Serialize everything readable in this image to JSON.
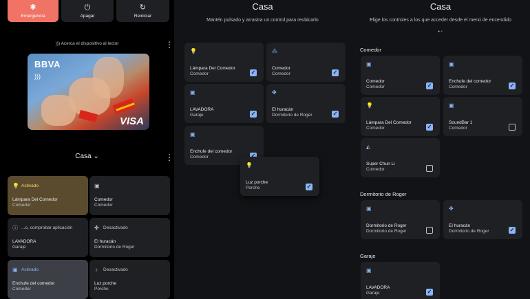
{
  "power_menu": {
    "emergency": {
      "label": "Emergencia",
      "icon": "asterisk-icon"
    },
    "power_off": {
      "label": "Apagar",
      "icon": "power-icon"
    },
    "restart": {
      "label": "Reiniciar",
      "icon": "restart-icon"
    }
  },
  "wallet": {
    "nfc_hint": "Acerca el dispositivo al lector",
    "card_brand": "BBVA",
    "card_network": "VISA"
  },
  "home_selector": {
    "label": "Casa"
  },
  "device_tiles": [
    {
      "status": "Activado",
      "name": "Lámpara Del Comedor",
      "room": "Comedor",
      "icon": "lightbulb-icon"
    },
    {
      "status": "",
      "name": "Comedor",
      "room": "Comedor",
      "icon": "speaker-icon"
    },
    {
      "status": "...o, comprobar aplicación",
      "name": "LAVADORA",
      "room": "Garaje",
      "icon": "info-icon"
    },
    {
      "status": "Desactivado",
      "name": "El huracán",
      "room": "Dormitorio de Roger",
      "icon": "fan-icon"
    },
    {
      "status": "Activado",
      "name": "Enchufe del comedor",
      "room": "Comedor",
      "icon": "outlet-icon"
    },
    {
      "status": "Desactivado",
      "name": "Luz porche",
      "room": "Porche",
      "icon": "lightbulb-icon"
    }
  ],
  "reorder": {
    "title": "Casa",
    "subtitle": "Mantén pulsado y arrastra un control para reubicarlo",
    "tiles": [
      {
        "name": "Lámpara Del Comedor",
        "room": "Comedor",
        "icon": "lightbulb-icon",
        "checked": true
      },
      {
        "name": "Comedor",
        "room": "Comedor",
        "icon": "speaker-icon",
        "checked": true
      },
      {
        "name": "LAVADORA",
        "room": "Garaje",
        "icon": "washer-icon",
        "checked": true
      },
      {
        "name": "El huracán",
        "room": "Dormitorio de Roger",
        "icon": "fan-icon",
        "checked": true
      },
      {
        "name": "Enchufe del comedor",
        "room": "Comedor",
        "icon": "outlet-icon",
        "checked": true
      },
      {
        "name": "Luz porche",
        "room": "Porche",
        "icon": "lightbulb-icon",
        "checked": true
      }
    ]
  },
  "choose": {
    "title": "Casa",
    "subtitle": "Elige los controles a los que acceder desde el menú de encendido",
    "sections": [
      {
        "name": "Comedor",
        "tiles": [
          {
            "name": "Comedor",
            "room": "Comedor",
            "icon": "speaker-icon",
            "checked": true
          },
          {
            "name": "Enchufe del comedor",
            "room": "Comedor",
            "icon": "outlet-icon",
            "checked": true
          },
          {
            "name": "Lámpara Del Comedor",
            "room": "Comedor",
            "icon": "lightbulb-icon",
            "checked": true
          },
          {
            "name": "SoundBar 1",
            "room": "Comedor",
            "icon": "speaker-icon",
            "checked": false
          },
          {
            "name": "Super Chun Li",
            "room": "Comedor",
            "icon": "vacuum-icon",
            "checked": false
          }
        ]
      },
      {
        "name": "Dormitorio de Roger",
        "tiles": [
          {
            "name": "Dormitorio de Roger",
            "room": "Dormitorio de Roger",
            "icon": "speaker-icon",
            "checked": false
          },
          {
            "name": "El huracán",
            "room": "Dormitorio de Roger",
            "icon": "fan-icon",
            "checked": true
          }
        ]
      },
      {
        "name": "Garaje",
        "tiles": [
          {
            "name": "LAVADORA",
            "room": "Garaje",
            "icon": "washer-icon",
            "checked": true
          }
        ]
      }
    ]
  },
  "colors": {
    "emergency": "#f07366",
    "active_light": "#5b4b2e",
    "accent": "#8ab4f8",
    "tile": "#1f2023"
  }
}
